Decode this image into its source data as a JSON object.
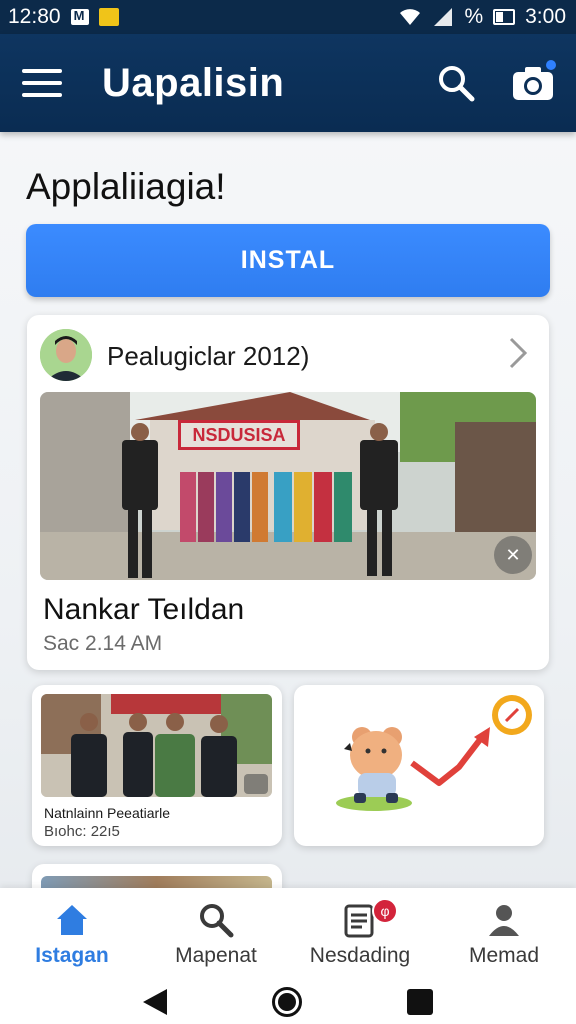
{
  "status_bar": {
    "time_left": "12:80",
    "battery_percent": "%",
    "time_right": "3:00"
  },
  "app_bar": {
    "title": "Uapalisin",
    "icons": [
      "menu-icon",
      "search-icon",
      "camera-icon"
    ]
  },
  "main": {
    "heading": "Applaliiagia!",
    "install_label": "INSTAL"
  },
  "feature_card": {
    "author": "Pealugiclar 2012)",
    "banner_text": "NSDUSISA",
    "title": "Nankar Teıldan",
    "time": "Sac 2.14 AM"
  },
  "small_cards": [
    {
      "title": "Natnlainn Peeatiarle",
      "date": "Bıohc: 22ı5"
    },
    {
      "title": "",
      "date": ""
    }
  ],
  "bottom_nav": {
    "items": [
      {
        "label": "Istagan",
        "icon": "home-icon",
        "active": true
      },
      {
        "label": "Mapenat",
        "icon": "search-icon",
        "active": false
      },
      {
        "label": "Nesdading",
        "icon": "news-icon",
        "active": false,
        "badge": "φ"
      },
      {
        "label": "Memad",
        "icon": "person-icon",
        "active": false
      }
    ]
  },
  "colors": {
    "app_bar": "#0c2f56",
    "accent": "#2f7de1",
    "badge": "#d3243b"
  }
}
